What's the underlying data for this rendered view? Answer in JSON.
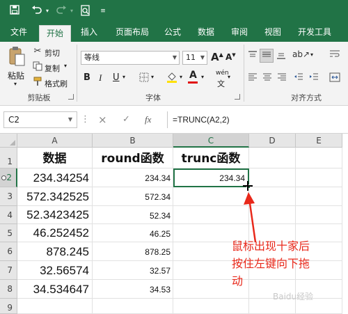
{
  "qat": {
    "save_icon": "save-icon",
    "undo_icon": "undo-icon",
    "redo_icon": "redo-icon",
    "preview_icon": "print-preview-icon"
  },
  "ribbon_tabs": [
    "文件",
    "开始",
    "插入",
    "页面布局",
    "公式",
    "数据",
    "审阅",
    "视图",
    "开发工具"
  ],
  "active_tab": "开始",
  "clipboard": {
    "paste": "粘贴",
    "cut": "剪切",
    "copy": "复制",
    "format_painter": "格式刷",
    "group_label": "剪贴板"
  },
  "font": {
    "name": "等线",
    "size": "11",
    "group_label": "字体",
    "bold": "B",
    "italic": "I",
    "underline": "U",
    "grow": "A",
    "shrink": "A",
    "font_color": "A",
    "phonetic": "wén"
  },
  "alignment": {
    "group_label": "对齐方式"
  },
  "formula_bar": {
    "name_box": "C2",
    "cancel": "×",
    "enter": "✓",
    "fx": "fx",
    "formula": "=TRUNC(A2,2)"
  },
  "columns": [
    "A",
    "B",
    "C",
    "D",
    "E"
  ],
  "rows": [
    "1",
    "2",
    "3",
    "4",
    "5",
    "6",
    "7",
    "8",
    "9"
  ],
  "sheet": {
    "header": {
      "a": "数据",
      "b": "round函数",
      "c": "trunc函数"
    },
    "data": [
      {
        "a": "234.34254",
        "b": "234.34",
        "c": "234.34"
      },
      {
        "a": "572.342525",
        "b": "572.34",
        "c": ""
      },
      {
        "a": "52.3423425",
        "b": "52.34",
        "c": ""
      },
      {
        "a": "46.252452",
        "b": "46.25",
        "c": ""
      },
      {
        "a": "878.245",
        "b": "878.25",
        "c": ""
      },
      {
        "a": "32.56574",
        "b": "32.57",
        "c": ""
      },
      {
        "a": "34.534647",
        "b": "34.53",
        "c": ""
      }
    ]
  },
  "selected_cell": "C2",
  "annotation": {
    "line1": "鼠标出现十家后",
    "line2": "按住左键向下拖",
    "line3": "动",
    "color": "#e8281a"
  },
  "watermark": "Baidu经验",
  "colors": {
    "excel_green": "#217346",
    "annotation_red": "#e8281a"
  }
}
